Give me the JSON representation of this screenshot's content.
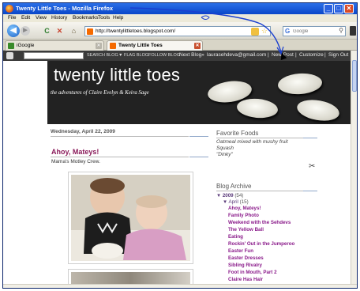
{
  "window": {
    "title": "Twenty Little Toes - Mozilla Firefox",
    "minimize_glyph": "_",
    "maximize_glyph": "□",
    "close_glyph": "✕"
  },
  "menu": [
    "File",
    "Edit",
    "View",
    "History",
    "Bookmarks",
    "Tools",
    "Help"
  ],
  "toolbar": {
    "back_glyph": "◀",
    "forward_glyph": "▶",
    "reload_glyph": "C",
    "stop_glyph": "✕",
    "home_glyph": "⌂",
    "url": "http://twentylittletoes.blogspot.com/",
    "search_placeholder": "Google",
    "search_engine_glyph": "G"
  },
  "tabs": [
    {
      "label": "iGoogle",
      "active": false,
      "icon_color": "#3a8a2a"
    },
    {
      "label": "Twenty Little Toes",
      "active": true,
      "icon_color": "#f56a00"
    }
  ],
  "blogger_nav": {
    "links": [
      "SEARCH BLOG",
      "▼ FLAG BLOG",
      "FOLLOW BLOG"
    ],
    "next_blog": "Next Blog»",
    "email": "laurasehdeva@gmail.com",
    "new_post": "New Post",
    "customize": "Customize",
    "sign_out": "Sign Out"
  },
  "header": {
    "title": "twenty little toes",
    "subtitle": "the adventures of Claire Evelyn & Keira Sage"
  },
  "post": {
    "date": "Wednesday, April 22, 2009",
    "title": "Ahoy, Mateys!",
    "subtitle": "Mama's Motley Crew."
  },
  "sidebar": {
    "favorite_foods": {
      "heading": "Favorite Foods",
      "items": [
        "Oatmeal mixed with mushy fruit",
        "Squash",
        "\"Dinky\""
      ]
    },
    "archive": {
      "heading": "Blog Archive",
      "year": {
        "label": "2009",
        "count": "(54)"
      },
      "month": {
        "label": "April",
        "count": "(15)"
      },
      "posts": [
        "Ahoy, Mateys!",
        "Family Photo",
        "Weekend with the Sehdevs",
        "The Yellow Ball",
        "Eating",
        "Rockin' Out in the Jumperoo",
        "Easter Fun",
        "Easter Dresses",
        "Sibling Rivalry",
        "Foot in Mouth, Part 2",
        "Claire Has Hair"
      ]
    }
  },
  "colors": {
    "title_bar": "#0a47c9",
    "post_title": "#8a1a5a",
    "archive_link": "#8a1a8a",
    "header_bg": "#222222",
    "annotation": "#1a3fd0"
  }
}
